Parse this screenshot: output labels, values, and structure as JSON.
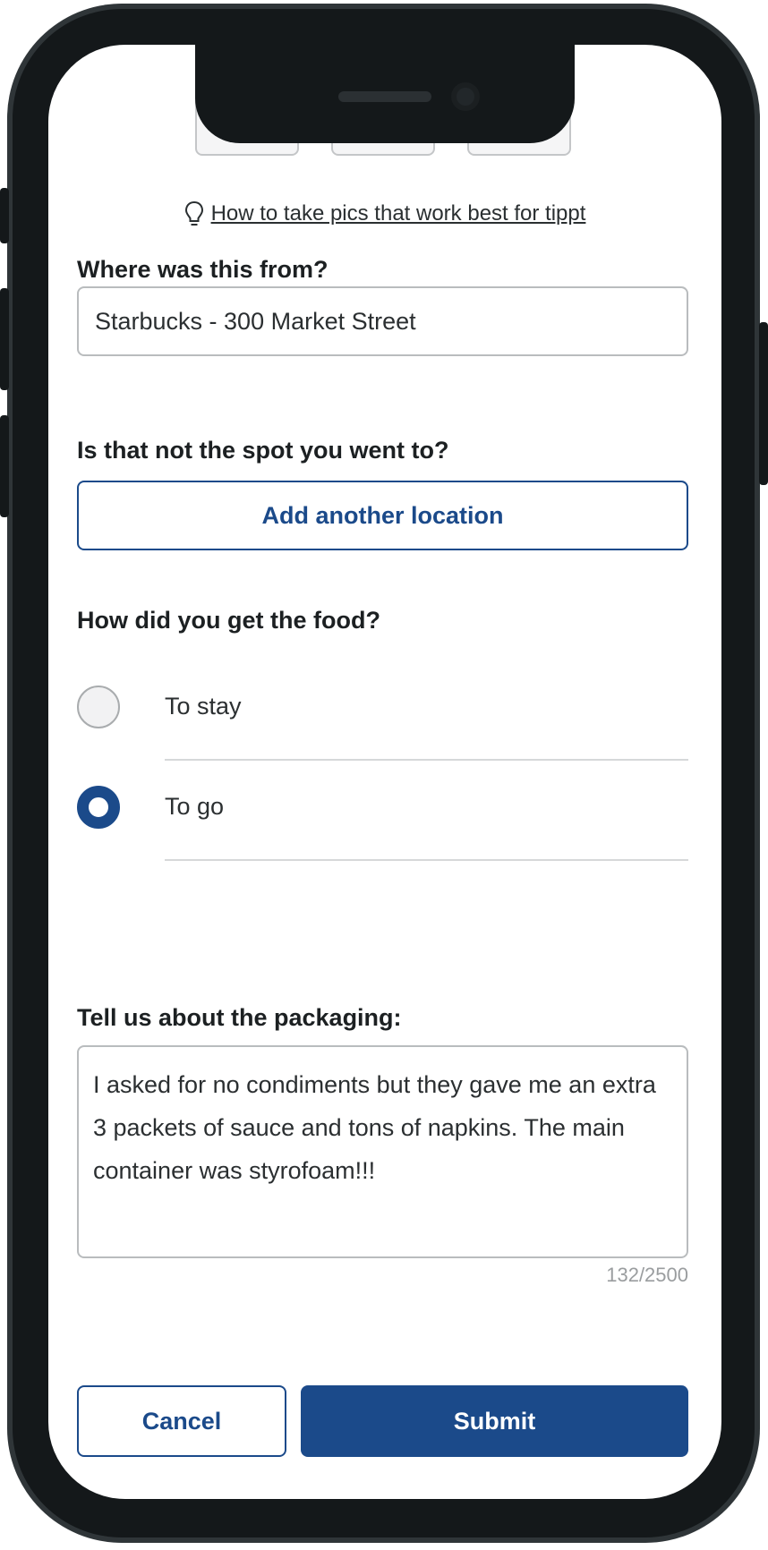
{
  "photos": {
    "slot_icon": "camera-icon"
  },
  "tip": {
    "icon": "lightbulb-icon",
    "link_text": "How to take pics that work best for tippt"
  },
  "location": {
    "label": "Where was this from?",
    "value": "Starbucks - 300 Market Street"
  },
  "alt_location": {
    "label": "Is that not the spot you went to?",
    "button": "Add another location"
  },
  "pickup": {
    "label": "How did you get the food?",
    "options": [
      {
        "label": "To stay",
        "selected": false
      },
      {
        "label": "To go",
        "selected": true
      }
    ]
  },
  "packaging": {
    "label": "Tell us about the packaging:",
    "value": "I asked for no condiments but they gave me an extra 3 packets of sauce and tons of napkins. The main container was styrofoam!!!",
    "counter": "132/2500"
  },
  "actions": {
    "cancel": "Cancel",
    "submit": "Submit"
  },
  "colors": {
    "accent": "#1b4a8a",
    "frame": "#14181a"
  }
}
